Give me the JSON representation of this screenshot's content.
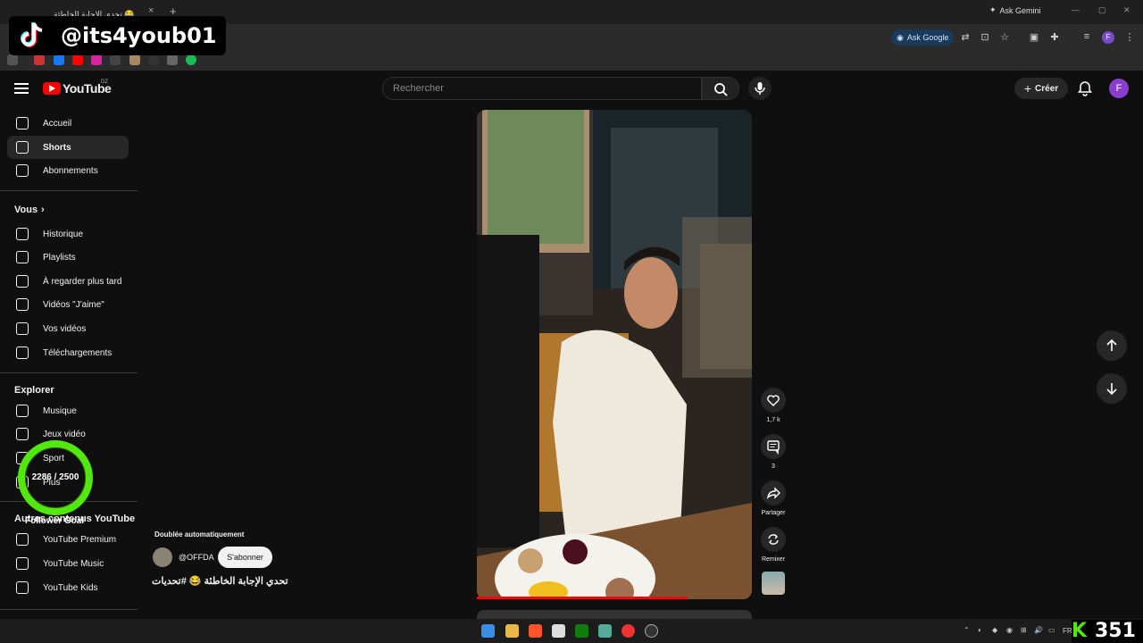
{
  "browser": {
    "tab_title": "تحدي الإجابة الخاطئة 😂",
    "tab_close": "×",
    "new_tab": "+",
    "gemini_label": "Ask Gemini",
    "ask_google_label": "Ask Google"
  },
  "overlay": {
    "handle": "@its4youb01",
    "goal_value": "2286 / 2500",
    "goal_label": "Follower Goal",
    "counter_prefix": "K",
    "counter_value": "351",
    "goal_fraction": 0.9144
  },
  "header": {
    "logo_text": "YouTube",
    "country_code": "DZ",
    "search_placeholder": "Rechercher",
    "create_label": "Créer",
    "avatar_letter": "F"
  },
  "sidebar": {
    "main": [
      {
        "label": "Accueil",
        "icon": "home-icon"
      },
      {
        "label": "Shorts",
        "icon": "shorts-icon",
        "active": true
      },
      {
        "label": "Abonnements",
        "icon": "subscriptions-icon"
      }
    ],
    "you_title": "Vous",
    "you_items": [
      {
        "label": "Historique",
        "icon": "history-icon"
      },
      {
        "label": "Playlists",
        "icon": "playlists-icon"
      },
      {
        "label": "À regarder plus tard",
        "icon": "watch-later-icon"
      },
      {
        "label": "Vidéos \"J'aime\"",
        "icon": "like-icon"
      },
      {
        "label": "Vos vidéos",
        "icon": "your-videos-icon"
      },
      {
        "label": "Téléchargements",
        "icon": "download-icon"
      }
    ],
    "explore_title": "Explorer",
    "explore_items": [
      {
        "label": "Musique",
        "icon": "music-icon"
      },
      {
        "label": "Jeux vidéo",
        "icon": "gaming-icon"
      },
      {
        "label": "Sport",
        "icon": "sport-icon"
      },
      {
        "label": "Plus",
        "icon": "more-icon"
      }
    ],
    "other_title": "Autres contenus YouTube",
    "other_items": [
      {
        "label": "YouTube Premium",
        "icon": "youtube-premium-icon"
      },
      {
        "label": "YouTube Music",
        "icon": "youtube-music-icon"
      },
      {
        "label": "YouTube Kids",
        "icon": "youtube-kids-icon"
      }
    ]
  },
  "short": {
    "dubbed_label": "Doublée automatiquement",
    "channel": "@OFFDA",
    "subscribe_label": "S'abonner",
    "title": "تحدي الإجابة الخاطئة 😂 #تحديات",
    "likes": "1,7 k",
    "comments": "3",
    "share_label": "Partager",
    "remix_label": "Remixer"
  },
  "taskbar": {
    "lang": "FR"
  },
  "colors": {
    "accent": "#ff0000",
    "goal_ring": "#52e80e",
    "avatar": "#8a3ecf"
  }
}
